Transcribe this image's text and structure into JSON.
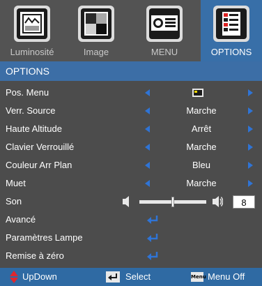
{
  "tabs": [
    {
      "label": "Luminosité",
      "icon": "picture-frame-icon"
    },
    {
      "label": "Image",
      "icon": "gray-pattern-icon"
    },
    {
      "label": "MENU",
      "icon": "projector-icon"
    },
    {
      "label": "OPTIONS",
      "icon": "options-list-icon"
    }
  ],
  "section": {
    "title": "OPTIONS"
  },
  "menu": {
    "items": [
      {
        "label": "Pos. Menu",
        "value": "",
        "control": "icon"
      },
      {
        "label": "Verr. Source",
        "value": "Marche",
        "control": "select"
      },
      {
        "label": "Haute Altitude",
        "value": "Arrêt",
        "control": "select"
      },
      {
        "label": "Clavier Verrouillé",
        "value": "Marche",
        "control": "select"
      },
      {
        "label": "Couleur Arr Plan",
        "value": "Bleu",
        "control": "select"
      },
      {
        "label": "Muet",
        "value": "Marche",
        "control": "select"
      },
      {
        "label": "Son",
        "value": "8",
        "control": "slider",
        "level": 0.5
      },
      {
        "label": "Avancé",
        "control": "enter"
      },
      {
        "label": "Paramètres Lampe",
        "control": "enter"
      },
      {
        "label": "Remise à zéro",
        "control": "enter"
      }
    ]
  },
  "footer": {
    "updown_label": "UpDown",
    "select_label": "Select",
    "menu_key_text": "Menu",
    "menu_off_label": "Menu Off"
  },
  "colors": {
    "accent": "#2f74d6",
    "header_bg": "#3c6ea6",
    "footer_bg": "#2f6aa3",
    "selected_tab_bg": "#386fa8",
    "menu_bg": "#4c4c4c",
    "updown_icon": "#e0262d",
    "enter_icon": "#2f74d6"
  }
}
